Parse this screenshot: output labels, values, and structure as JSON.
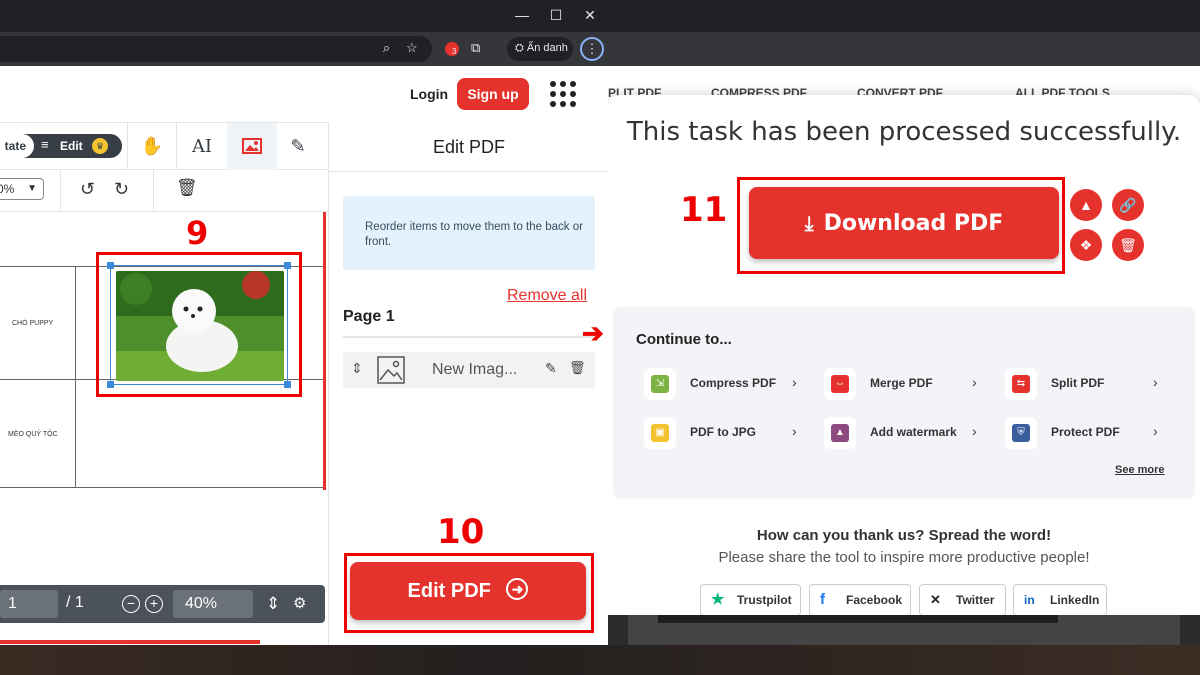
{
  "colors": {
    "brand_red": "#e5322d",
    "annotation_red": "#ee0000",
    "selection_blue": "#3b8bd9",
    "dark_chrome": "#202124"
  },
  "browser": {
    "window_controls": [
      "—",
      "☐",
      "✕"
    ],
    "extension_badge": "3",
    "incognito_label": "Ẩn danh"
  },
  "left": {
    "header": {
      "login": "Login",
      "signup": "Sign up"
    },
    "toolbar": {
      "mode_rotate": "tate",
      "mode_edit": "Edit",
      "tools": [
        "hand-icon",
        "text-tool-icon",
        "image-tool-icon",
        "pen-icon"
      ]
    },
    "subtoolbar": {
      "zoom_value": "0%",
      "icons": [
        "rotate-left-icon",
        "rotate-right-icon",
        "trash-icon"
      ]
    },
    "document": {
      "row1_label": "CHÓ PUPPY",
      "row2_label": "MÈO QUÝ TỘC"
    },
    "bottombar": {
      "page_current": "1",
      "page_total": "/ 1",
      "zoom": "40%"
    },
    "sidebar": {
      "title": "Edit PDF",
      "note": "Reorder items to move them to the back or front.",
      "remove_all": "Remove all",
      "page_label": "Page 1",
      "item_label": "New Imag...",
      "edit_button": "Edit PDF"
    },
    "steps": {
      "step9": "9",
      "step10": "10"
    }
  },
  "right": {
    "nav": [
      "PLIT PDF",
      "COMPRESS PDF",
      "CONVERT PDF",
      "ALL PDF TOOLS"
    ],
    "success_title": "This task has been processed successfully.",
    "download_button": "Download PDF",
    "step11": "11",
    "side_actions": [
      "google-drive-icon",
      "link-icon",
      "dropbox-icon",
      "delete-icon"
    ],
    "continue": {
      "title": "Continue to...",
      "tools": [
        {
          "label": "Compress PDF",
          "color": "#7cb342",
          "glyph": "⇲"
        },
        {
          "label": "Merge PDF",
          "color": "#e5322d",
          "glyph": "⇔"
        },
        {
          "label": "Split PDF",
          "color": "#e5322d",
          "glyph": "⇆"
        },
        {
          "label": "PDF to JPG",
          "color": "#f4c430",
          "glyph": "▣"
        },
        {
          "label": "Add watermark",
          "color": "#8e4a80",
          "glyph": "▲"
        },
        {
          "label": "Protect PDF",
          "color": "#3a5d9c",
          "glyph": "⛨"
        }
      ],
      "see_more": "See more"
    },
    "thanks": "How can you thank us? Spread the word!",
    "share_text": "Please share the tool to inspire more productive people!",
    "share_buttons": [
      {
        "label": "Trustpilot",
        "icon": "★",
        "color": "#00b67a"
      },
      {
        "label": "Facebook",
        "icon": "f",
        "color": "#1877f2"
      },
      {
        "label": "Twitter",
        "icon": "𝕏",
        "color": "#222"
      },
      {
        "label": "LinkedIn",
        "icon": "in",
        "color": "#0a66c2"
      }
    ]
  }
}
